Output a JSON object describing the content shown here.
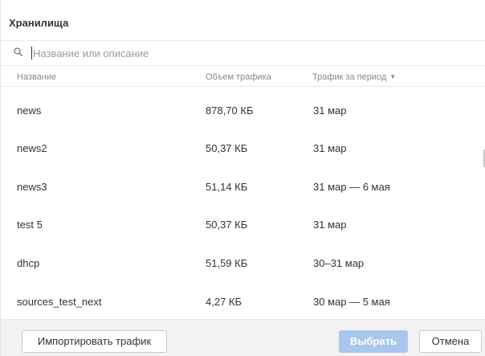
{
  "dialog": {
    "title": "Хранилища"
  },
  "search": {
    "placeholder": "Название или описание",
    "value": ""
  },
  "table": {
    "columns": [
      {
        "label": "Название"
      },
      {
        "label": "Объем трафика"
      },
      {
        "label": "Трафик за период",
        "sort_icon": "chevron-down-icon"
      }
    ],
    "rows": [
      {
        "name": "news",
        "volume": "878,70 КБ",
        "period": "31 мар"
      },
      {
        "name": "news2",
        "volume": "50,37 КБ",
        "period": "31 мар"
      },
      {
        "name": "news3",
        "volume": "51,14 КБ",
        "period": "31 мар — 6 мая"
      },
      {
        "name": "test 5",
        "volume": "50,37 КБ",
        "period": "31 мар"
      },
      {
        "name": "dhcp",
        "volume": "51,59 КБ",
        "period": "30–31 мар"
      },
      {
        "name": "sources_test_next",
        "volume": "4,27 КБ",
        "period": "30 мар — 5 мая"
      }
    ]
  },
  "footer": {
    "import_label": "Импортировать трафик",
    "select_label": "Выбрать",
    "cancel_label": "Отмена"
  },
  "colors": {
    "primary_disabled": "#a9c7ec",
    "footer_bg": "#f2f2f2",
    "text": "#333333",
    "muted_text": "#8a8a8a"
  }
}
